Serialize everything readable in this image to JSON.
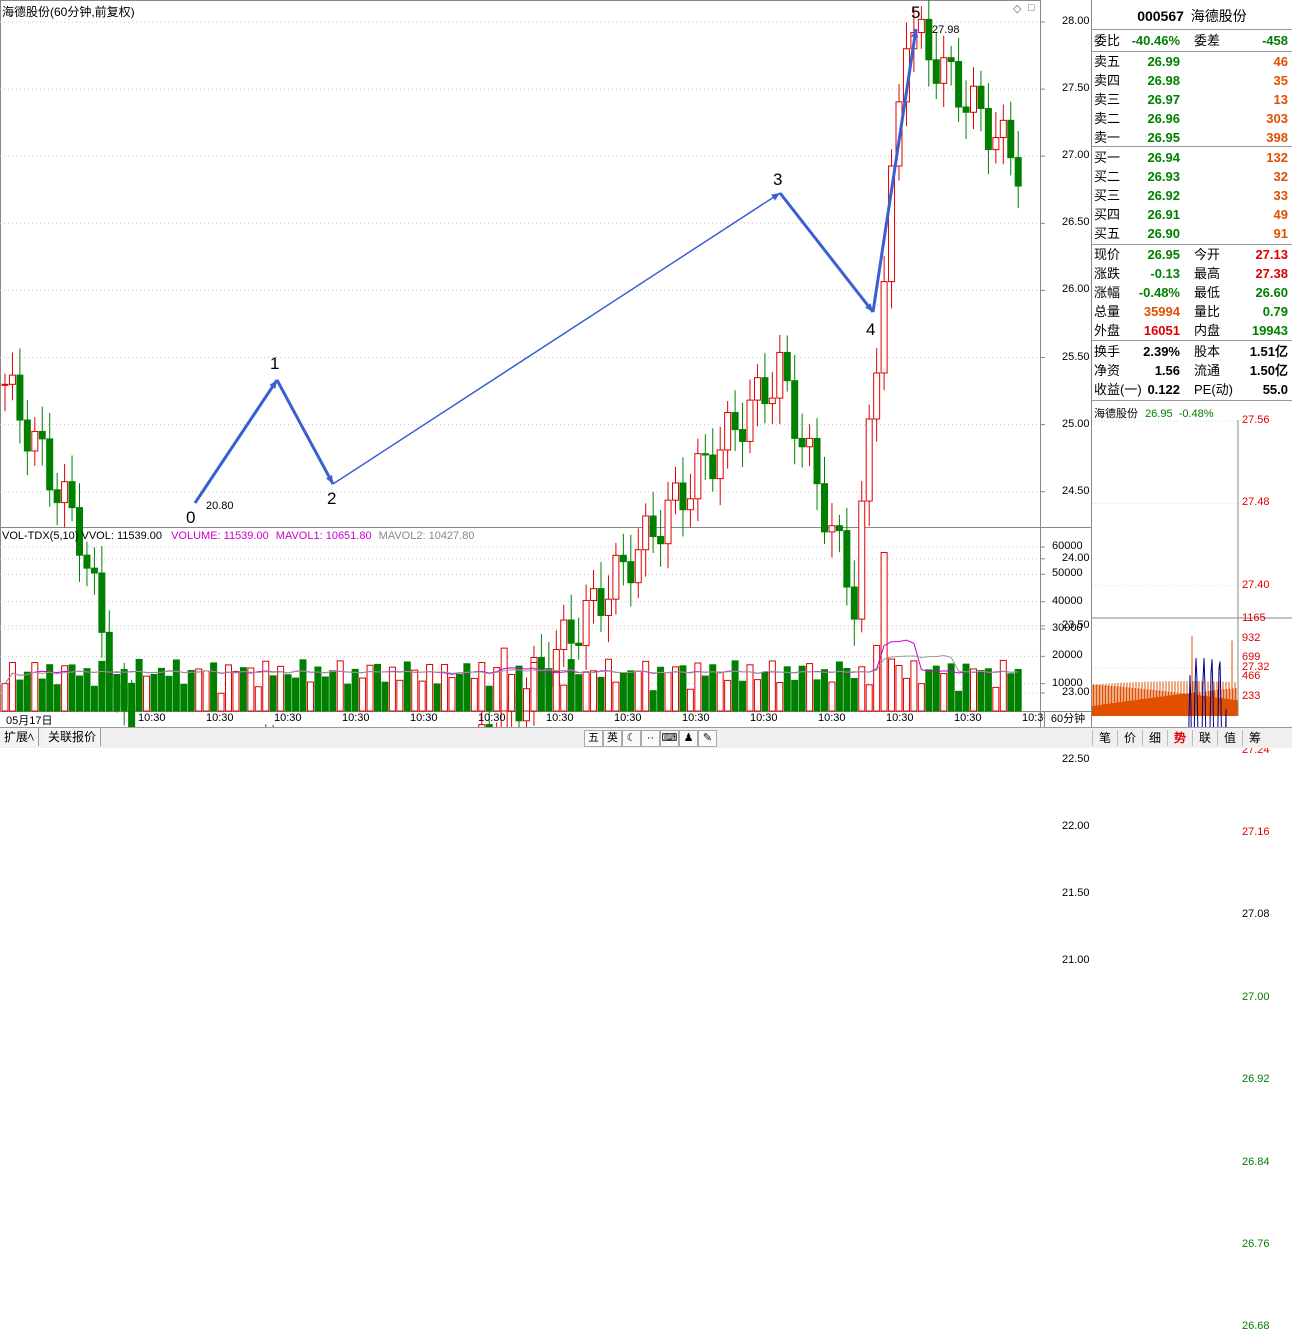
{
  "main_chart": {
    "title": "海德股份(60分钟,前复权)",
    "y_ticks": [
      "28.00",
      "27.50",
      "27.00",
      "26.50",
      "26.00",
      "25.50",
      "25.00",
      "24.50",
      "24.00",
      "23.50",
      "23.00",
      "22.50",
      "22.00",
      "21.50",
      "21.00"
    ],
    "wave_labels": [
      "0",
      "1",
      "2",
      "3",
      "4",
      "5"
    ],
    "low_label": "20.80",
    "high_label": "27.98"
  },
  "volume_chart": {
    "indicator_name": "VOL-TDX(5,10)",
    "vvol": "VVOL: 11539.00",
    "volume": "VOLUME: 11539.00",
    "mavol1": "MAVOL1: 10651.80",
    "mavol2": "MAVOL2: 10427.80",
    "y_ticks": [
      "60000",
      "50000",
      "40000",
      "30000",
      "20000",
      "10000"
    ],
    "x_labels": [
      "05月17日",
      "10:30",
      "10:30",
      "10:30",
      "10:30",
      "10:30",
      "10:30",
      "10:30",
      "10:30",
      "10:30",
      "10:30",
      "10:30",
      "10:30",
      "10:30",
      "10:30"
    ],
    "period": "60分钟"
  },
  "quote": {
    "code": "000567",
    "name": "海德股份",
    "weibi_label": "委比",
    "weibi": "-40.46%",
    "weicha_label": "委差",
    "weicha": "-458",
    "sells": [
      {
        "label": "卖五",
        "price": "26.99",
        "vol": "46"
      },
      {
        "label": "卖四",
        "price": "26.98",
        "vol": "35"
      },
      {
        "label": "卖三",
        "price": "26.97",
        "vol": "13"
      },
      {
        "label": "卖二",
        "price": "26.96",
        "vol": "303"
      },
      {
        "label": "卖一",
        "price": "26.95",
        "vol": "398"
      }
    ],
    "buys": [
      {
        "label": "买一",
        "price": "26.94",
        "vol": "132"
      },
      {
        "label": "买二",
        "price": "26.93",
        "vol": "32"
      },
      {
        "label": "买三",
        "price": "26.92",
        "vol": "33"
      },
      {
        "label": "买四",
        "price": "26.91",
        "vol": "49"
      },
      {
        "label": "买五",
        "price": "26.90",
        "vol": "91"
      }
    ],
    "stats1": [
      {
        "l1": "现价",
        "v1": "26.95",
        "c1": "green",
        "l2": "今开",
        "v2": "27.13",
        "c2": "red"
      },
      {
        "l1": "涨跌",
        "v1": "-0.13",
        "c1": "green",
        "l2": "最高",
        "v2": "27.38",
        "c2": "red"
      },
      {
        "l1": "涨幅",
        "v1": "-0.48%",
        "c1": "green",
        "l2": "最低",
        "v2": "26.60",
        "c2": "green"
      },
      {
        "l1": "总量",
        "v1": "35994",
        "c1": "orange",
        "l2": "量比",
        "v2": "0.79",
        "c2": "green"
      },
      {
        "l1": "外盘",
        "v1": "16051",
        "c1": "red",
        "l2": "内盘",
        "v2": "19943",
        "c2": "green"
      }
    ],
    "stats2": [
      {
        "l1": "换手",
        "v1": "2.39%",
        "l2": "股本",
        "v2": "1.51亿"
      },
      {
        "l1": "净资",
        "v1": "1.56",
        "l2": "流通",
        "v2": "1.50亿"
      },
      {
        "l1": "收益(一)",
        "v1": "0.122",
        "l2": "PE(动)",
        "v2": "55.0"
      }
    ]
  },
  "mini_chart": {
    "name": "海德股份",
    "price": "26.95",
    "pct": "-0.48%",
    "price_ticks": [
      "27.56",
      "27.48",
      "27.40",
      "27.32",
      "27.24",
      "27.16",
      "27.08",
      "27.00",
      "26.92",
      "26.84",
      "26.76",
      "26.68"
    ],
    "vol_ticks": [
      "1165",
      "932",
      "699",
      "466",
      "233"
    ]
  },
  "bottom_bar": {
    "tabs": [
      "扩展ﾍ",
      "关联报价"
    ],
    "icons": [
      "五",
      "英",
      "☾",
      "··",
      "⌨",
      "♟",
      "✎"
    ],
    "right_tabs": [
      "笔",
      "价",
      "细",
      "势",
      "联",
      "值",
      "筹"
    ]
  },
  "colors": {
    "up": "#e00000",
    "down": "#008000",
    "wave": "#3a5fd0",
    "mavol1": "#cc00cc",
    "mavol2": "#999999"
  }
}
